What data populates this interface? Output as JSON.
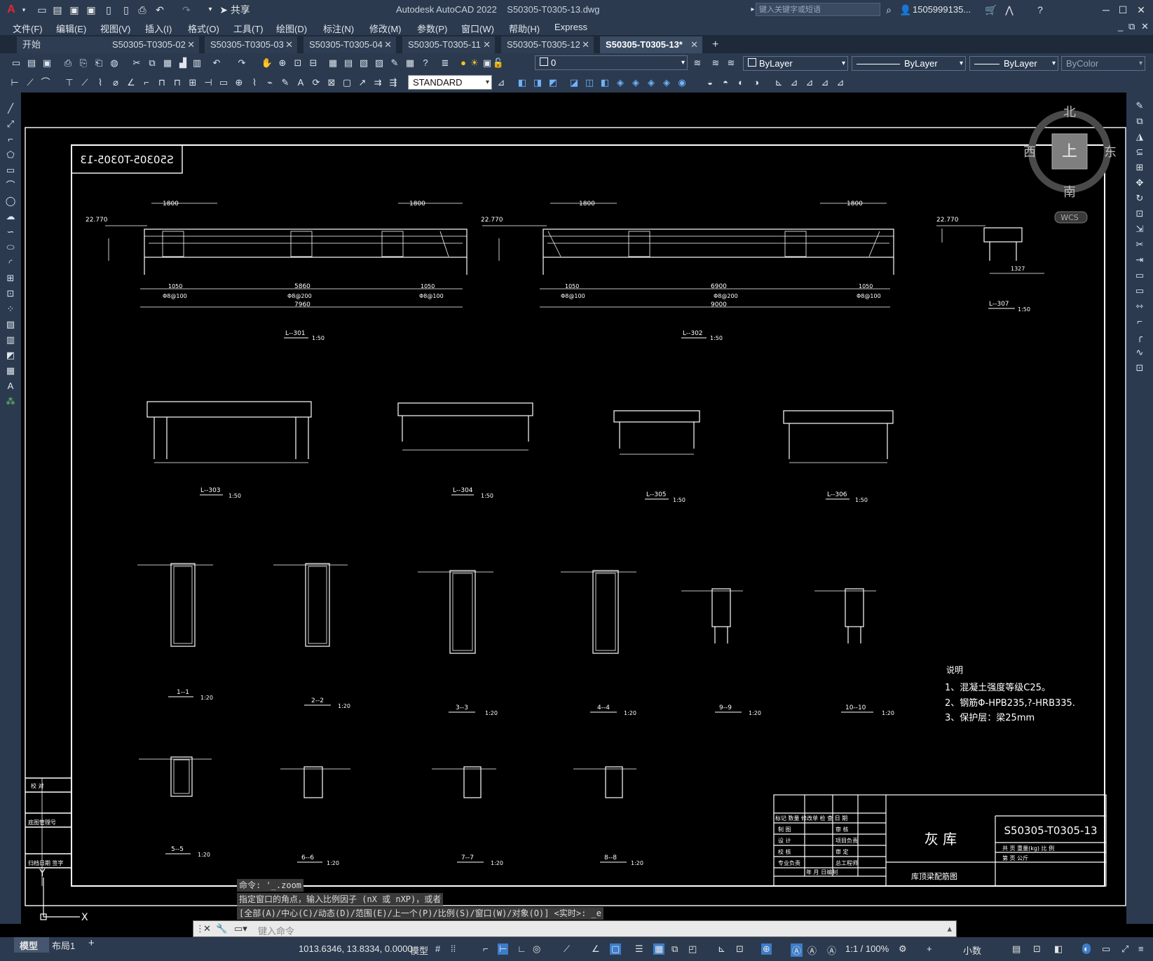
{
  "app": {
    "title": "Autodesk AutoCAD 2022",
    "filename": "S50305-T0305-13.dwg",
    "share_label": "共享",
    "search_placeholder": "键入关键字或短语",
    "user": "1505999135...",
    "accent_color": "#e8262d"
  },
  "menubar": {
    "items": [
      "文件(F)",
      "编辑(E)",
      "视图(V)",
      "插入(I)",
      "格式(O)",
      "工具(T)",
      "绘图(D)",
      "标注(N)",
      "修改(M)",
      "参数(P)",
      "窗口(W)",
      "帮助(H)",
      "Express"
    ]
  },
  "tabs": [
    {
      "label": "开始",
      "active": false
    },
    {
      "label": "S50305-T0305-02",
      "active": false
    },
    {
      "label": "S50305-T0305-03",
      "active": false
    },
    {
      "label": "S50305-T0305-04",
      "active": false
    },
    {
      "label": "S50305-T0305-11",
      "active": false
    },
    {
      "label": "S50305-T0305-12",
      "active": false
    },
    {
      "label": "S50305-T0305-13*",
      "active": true
    }
  ],
  "properties": {
    "layer": "0",
    "color": "ByLayer",
    "linetype": "ByLayer",
    "lineweight": "ByLayer",
    "plotstyle": "ByColor",
    "textstyle": "STANDARD"
  },
  "viewcube": {
    "north": "北",
    "south": "南",
    "west": "西",
    "east": "东",
    "face": "上",
    "wcs": "WCS"
  },
  "drawing": {
    "sheet_id_box": "S50305-T0305-13",
    "beams_top": [
      {
        "label": "L--301",
        "scale": "1:50"
      },
      {
        "label": "L--302",
        "scale": "1:50"
      },
      {
        "label": "L--307",
        "scale": "1:50"
      }
    ],
    "beams_mid": [
      {
        "label": "L--303",
        "scale": "1:50"
      },
      {
        "label": "L--304",
        "scale": "1:50"
      },
      {
        "label": "L--305",
        "scale": "1:50"
      },
      {
        "label": "L--306",
        "scale": "1:50"
      }
    ],
    "sections_row1": [
      {
        "label": "1--1",
        "scale": "1:20"
      },
      {
        "label": "2--2",
        "scale": "1:20"
      },
      {
        "label": "3--3",
        "scale": "1:20"
      },
      {
        "label": "4--4",
        "scale": "1:20"
      },
      {
        "label": "9--9",
        "scale": "1:20"
      },
      {
        "label": "10--10",
        "scale": "1:20"
      }
    ],
    "sections_row2": [
      {
        "label": "5--5",
        "scale": "1:20"
      },
      {
        "label": "6--6",
        "scale": "1:20"
      },
      {
        "label": "7--7",
        "scale": "1:20"
      },
      {
        "label": "8--8",
        "scale": "1:20"
      }
    ],
    "notes": {
      "title": "说明",
      "lines": [
        "1、混凝土强度等级C25。",
        "2、钢筋Φ-HPB235,?-HRB335.",
        "3、保护层：梁25mm"
      ]
    },
    "dims": {
      "l301": [
        "1800",
        "1800",
        "5860",
        "7960",
        "1050",
        "1050",
        "Φ8@100",
        "Φ8@200",
        "Φ8@100",
        "22.770"
      ],
      "l302": [
        "1800",
        "1800",
        "6900",
        "9000",
        "1050",
        "1050",
        "Φ8@100",
        "Φ8@200",
        "Φ8@100",
        "22.770"
      ],
      "l307": [
        "1327",
        "22.770"
      ]
    },
    "titleblock": {
      "project": "灰 库",
      "sheet_no": "S50305-T0305-13",
      "sheet_name": "库顶梁配筋图",
      "rows_left": [
        "标记",
        "制 图",
        "设 计",
        "校 核",
        "专业负责"
      ],
      "rows_mid": [
        "审 核",
        "项目负责",
        "审 定",
        "总工程师"
      ],
      "header": "标记 数量 修改单 检 查 日 期",
      "date_row": "年 月 日编制",
      "info1": "共 页 重量(kg) 比 例",
      "info2": "第 页 公斤",
      "side_labels": [
        "校 对",
        "底图管理号",
        "归档日期 签字"
      ]
    }
  },
  "command": {
    "history": [
      "命令: '_.zoom",
      "指定窗口的角点，输入比例因子 (nX 或 nXP)，或者",
      "[全部(A)/中心(C)/动态(D)/范围(E)/上一个(P)/比例(S)/窗口(W)/对象(O)] <实时>: _e"
    ],
    "placeholder": "键入命令"
  },
  "statusbar": {
    "tabs": [
      "模型",
      "布局1"
    ],
    "coords": "1013.6346, 13.8334, 0.0000",
    "mode": "模型",
    "scale": "1:1 / 100%",
    "units": "小数"
  }
}
